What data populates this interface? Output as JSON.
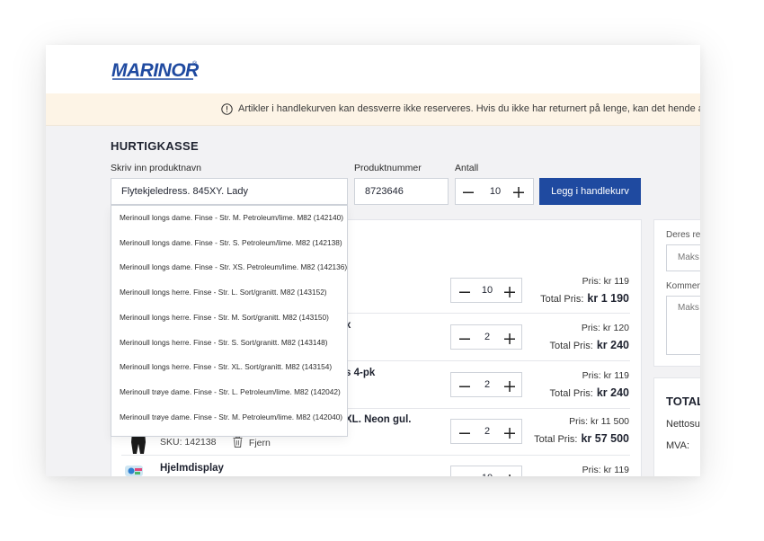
{
  "header": {
    "logo_text": "MARINOR",
    "logo_mark": "®"
  },
  "notice": {
    "text": "Artikler i handlekurven kan dessverre ikke reserveres.  Hvis du ikke har returnert på lenge, kan det hende at noen var"
  },
  "quick_checkout": {
    "title": "HURTIGKASSE",
    "product_name_label": "Skriv inn produktnavn",
    "product_name_value": "Flytekjeledress. 845XY. Lady",
    "product_number_label": "Produktnummer",
    "product_number_value": "8723646",
    "quantity_label": "Antall",
    "quantity_value": "10",
    "add_button": "Legg i handlekurv"
  },
  "suggestions": [
    "Merinoull longs dame. Finse - Str. M. Petroleum/lime. M82 (142140)",
    "Merinoull longs dame. Finse - Str. S. Petroleum/lime. M82 (142138)",
    "Merinoull longs dame. Finse - Str. XS. Petroleum/lime. M82 (142136)",
    "Merinoull longs herre. Finse - Str. L. Sort/granitt. M82 (143152)",
    "Merinoull longs herre. Finse - Str. M. Sort/granitt. M82 (143150)",
    "Merinoull longs herre. Finse - Str. S. Sort/granitt. M82 (143148)",
    "Merinoull longs herre. Finse - Str. XL. Sort/granitt. M82 (143154)",
    "Merinoull trøye dame. Finse - Str. L. Petroleum/lime. M82 (142042)",
    "Merinoull trøye dame. Finse - Str. M. Petroleum/lime. M82 (142040)"
  ],
  "cart": {
    "rows": [
      {
        "name": "",
        "qty": "10",
        "price_label": "Pris:",
        "price": "kr 119",
        "total_label": "Total Pris:",
        "total": "kr 1 190"
      },
      {
        "name": "x",
        "qty": "2",
        "price_label": "Pris:",
        "price": "kr 120",
        "total_label": "Total Pris:",
        "total": "kr 240"
      },
      {
        "name": "s 4-pk",
        "qty": "2",
        "price_label": "Pris:",
        "price": "kr 119",
        "total_label": "Total Pris:",
        "total": "kr 240"
      },
      {
        "name": "XL. Neon gul.",
        "sku": "SKU: 142138",
        "remove": "Fjern",
        "qty": "2",
        "price_label": "Pris:",
        "price": "kr 11 500",
        "total_label": "Total Pris:",
        "total": "kr 57 500"
      },
      {
        "name": "Hjelmdisplay",
        "qty": "10",
        "price_label": "Pris:",
        "price": "kr 119"
      }
    ]
  },
  "side": {
    "reference_label": "Deres re",
    "reference_placeholder": "Maks",
    "comment_label": "Kommen",
    "comment_placeholder": "Maks",
    "totals_title": "TOTAL",
    "net_label": "Nettosu",
    "vat_label": "MVA:"
  },
  "colors": {
    "brand": "#1f4aa0",
    "notice_bg": "#fdf4e6",
    "page_bg": "#f2f2f4"
  }
}
